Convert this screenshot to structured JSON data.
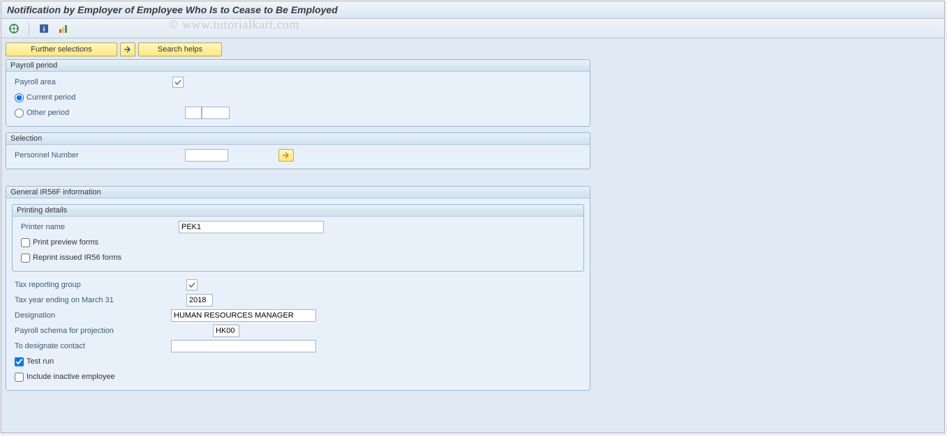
{
  "title": "Notification by Employer of Employee Who Is to Cease to Be Employed",
  "watermark": "© www.tutorialkart.com",
  "toolbar": {
    "further_selections": "Further selections",
    "search_helps": "Search helps"
  },
  "groups": {
    "payroll_period": {
      "title": "Payroll period",
      "payroll_area_label": "Payroll area",
      "current_period": "Current period",
      "other_period": "Other period"
    },
    "selection": {
      "title": "Selection",
      "personnel_number": "Personnel Number"
    },
    "general": {
      "title": "General IR56F information",
      "printing": {
        "title": "Printing details",
        "printer_name_label": "Printer name",
        "printer_name_value": "PEK1",
        "print_preview": "Print preview forms",
        "reprint": "Reprint issued IR56 forms"
      },
      "tax_reporting_group": "Tax reporting group",
      "tax_year_label": "Tax year ending on March 31",
      "tax_year_value": "2018",
      "designation_label": "Designation",
      "designation_value": "HUMAN RESOURCES MANAGER",
      "payroll_schema_label": "Payroll schema for projection",
      "payroll_schema_value": "HK00",
      "to_designate_contact": "To designate contact",
      "test_run": "Test run",
      "include_inactive": "Include inactive employee"
    }
  }
}
